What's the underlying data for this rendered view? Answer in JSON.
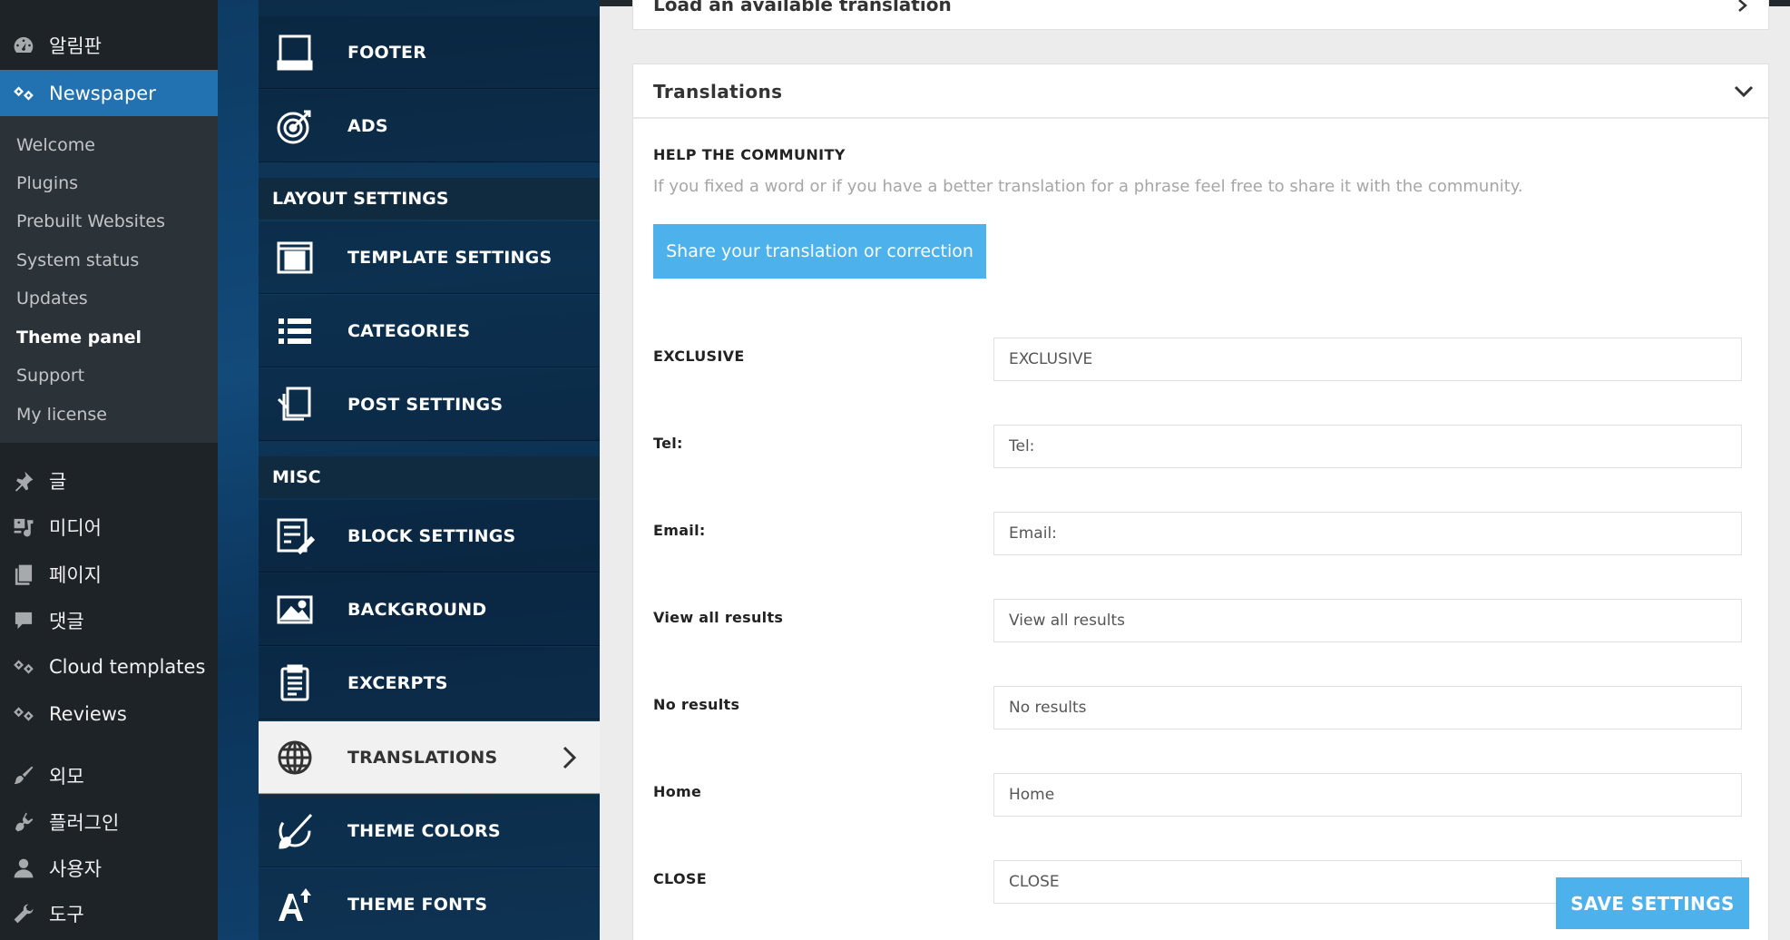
{
  "wp_sidebar": {
    "top": {
      "dashboard": "알림판",
      "newspaper": "Newspaper"
    },
    "submenu": [
      "Welcome",
      "Plugins",
      "Prebuilt Websites",
      "System status",
      "Updates",
      "Theme panel",
      "Support",
      "My license"
    ],
    "items": {
      "posts": "글",
      "media": "미디어",
      "pages": "페이지",
      "comments": "댓글",
      "cloud_templates": "Cloud templates",
      "reviews": "Reviews",
      "appearance": "외모",
      "plugins": "플러그인",
      "users": "사용자",
      "tools": "도구"
    },
    "accent_color": "#2271b1"
  },
  "theme_panel": {
    "items": {
      "footer": "FOOTER",
      "ads": "ADS",
      "layout_settings": "LAYOUT SETTINGS",
      "template_settings": "TEMPLATE SETTINGS",
      "categories": "CATEGORIES",
      "post_settings": "POST SETTINGS",
      "misc": "MISC",
      "block_settings": "BLOCK SETTINGS",
      "background": "BACKGROUND",
      "excerpts": "EXCERPTS",
      "translations": "TRANSLATIONS",
      "theme_colors": "THEME COLORS",
      "theme_fonts": "THEME FONTS"
    }
  },
  "content": {
    "load_box_title": "Load an available translation",
    "translations_title": "Translations",
    "help_title": "HELP THE COMMUNITY",
    "help_text": "If you fixed a word or if you have a better translation for a phrase feel free to share it with the community.",
    "share_button": "Share your translation or correction",
    "rows": [
      {
        "label": "EXCLUSIVE",
        "value": "EXCLUSIVE"
      },
      {
        "label": "Tel:",
        "value": "Tel:"
      },
      {
        "label": "Email:",
        "value": "Email:"
      },
      {
        "label": "View all results",
        "value": "View all results"
      },
      {
        "label": "No results",
        "value": "No results"
      },
      {
        "label": "Home",
        "value": "Home"
      },
      {
        "label": "CLOSE",
        "value": "CLOSE"
      }
    ],
    "save_button": "SAVE SETTINGS",
    "button_color": "#4db2ec"
  }
}
